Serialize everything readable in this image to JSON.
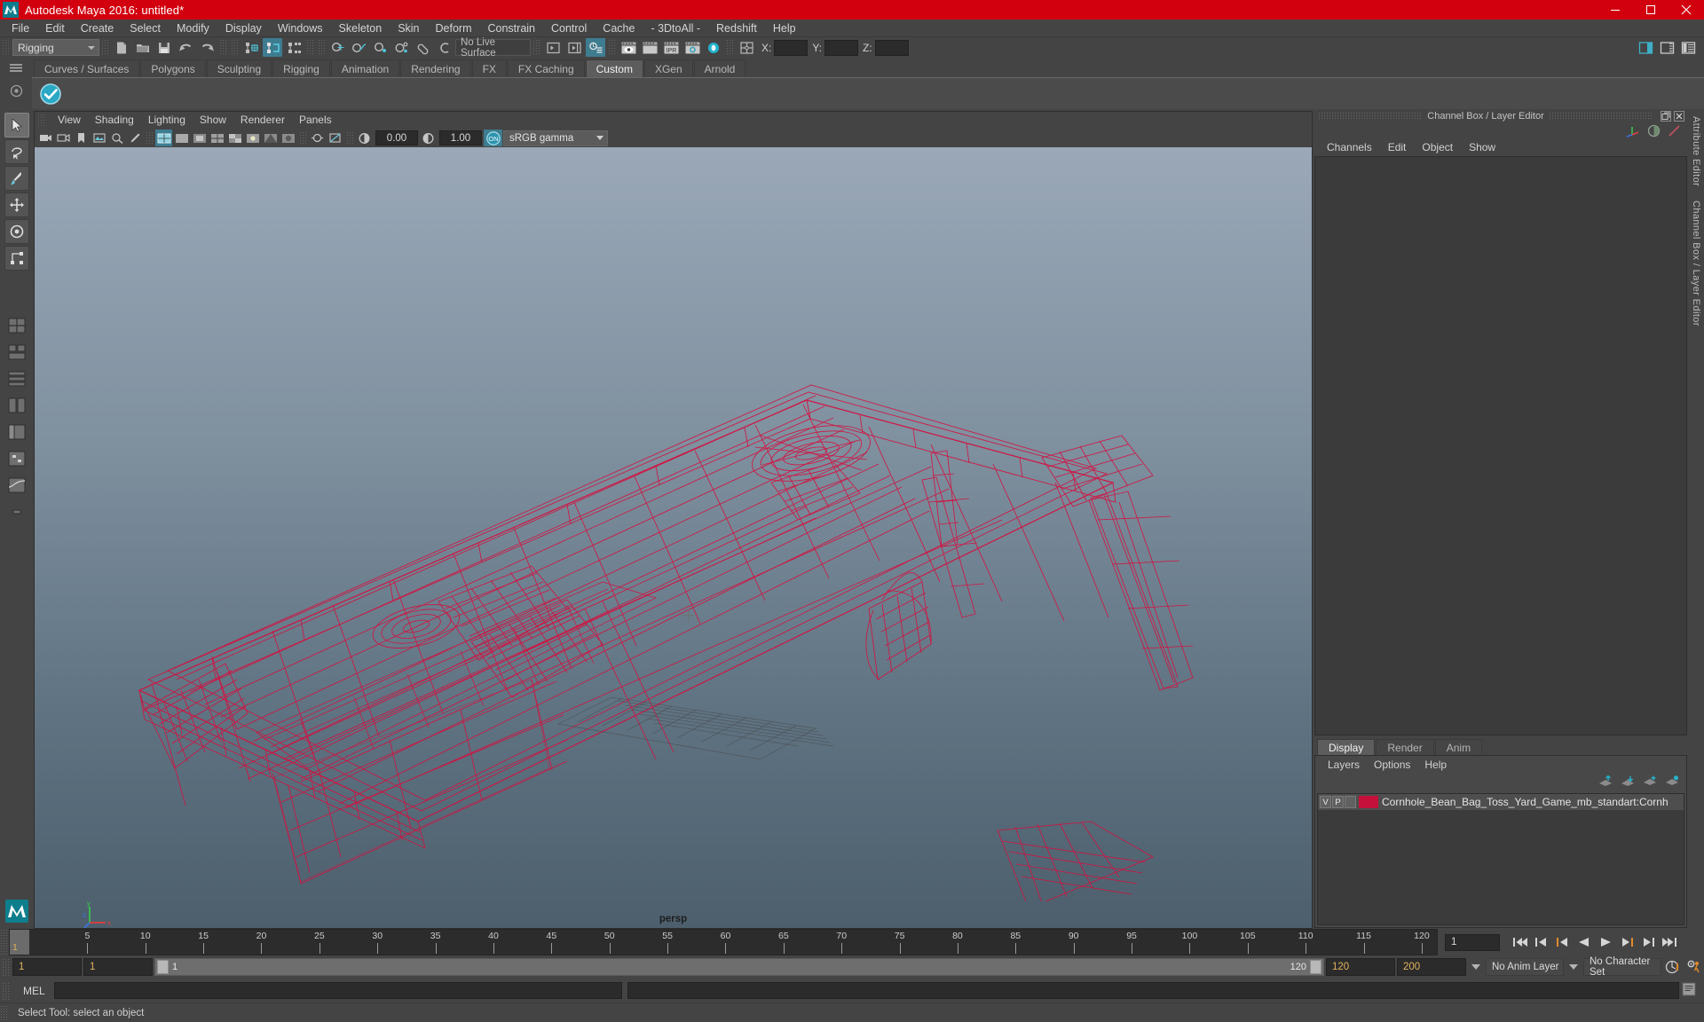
{
  "window": {
    "title": "Autodesk Maya 2016: untitled*",
    "titlebar_color": "#d2000f",
    "minimize": "minimize-icon",
    "maximize": "maximize-icon",
    "close": "close-icon"
  },
  "main_menu": [
    "File",
    "Edit",
    "Create",
    "Select",
    "Modify",
    "Display",
    "Windows",
    "Skeleton",
    "Skin",
    "Deform",
    "Constrain",
    "Control",
    "Cache",
    "- 3DtoAll -",
    "Redshift",
    "Help"
  ],
  "status_line": {
    "menu_set": "Rigging",
    "live_surface": "No Live Surface",
    "coord_labels": [
      "X:",
      "Y:",
      "Z:"
    ],
    "coord_values": [
      "",
      "",
      ""
    ]
  },
  "shelf": {
    "tabs": [
      "Curves / Surfaces",
      "Polygons",
      "Sculpting",
      "Rigging",
      "Animation",
      "Rendering",
      "FX",
      "FX Caching",
      "Custom",
      "XGen",
      "Arnold"
    ],
    "active_tab": "Custom"
  },
  "viewport": {
    "menus": [
      "View",
      "Shading",
      "Lighting",
      "Show",
      "Renderer",
      "Panels"
    ],
    "exposure": "0.00",
    "gamma": "1.00",
    "color_profile": "sRGB gamma",
    "camera_label": "persp",
    "wireframe_color": "#d31140",
    "grid_color": "#4d4d4d",
    "axis_labels": [
      "x",
      "y",
      "z"
    ]
  },
  "channel_box": {
    "panel_title": "Channel Box / Layer Editor",
    "menus": [
      "Channels",
      "Edit",
      "Object",
      "Show"
    ]
  },
  "layer_editor": {
    "tabs": [
      "Display",
      "Render",
      "Anim"
    ],
    "active_tab": "Display",
    "menus": [
      "Layers",
      "Options",
      "Help"
    ],
    "columns": [
      "V",
      "P"
    ],
    "layers": [
      {
        "visible": "V",
        "playback": "P",
        "state": "",
        "color": "#c4103a",
        "name": "Cornhole_Bean_Bag_Toss_Yard_Game_mb_standart:Cornh"
      }
    ]
  },
  "attribute_editor": {
    "labels": [
      "Attribute Editor",
      "Channel Box / Layer Editor"
    ]
  },
  "timeline": {
    "ticks": [
      5,
      10,
      15,
      20,
      25,
      30,
      35,
      40,
      45,
      50,
      55,
      60,
      65,
      70,
      75,
      80,
      85,
      90,
      95,
      100,
      105,
      110,
      115,
      120
    ],
    "current_frame": "1",
    "current_frame_field": "1",
    "playback_buttons": [
      "go-to-start",
      "step-back-key",
      "step-back-frame",
      "play-backwards",
      "play-forwards",
      "step-forward-frame",
      "step-forward-key",
      "go-to-end"
    ]
  },
  "range_slider": {
    "anim_start": "1",
    "playback_start": "1",
    "range_left_label": "1",
    "range_right_label": "120",
    "playback_end": "120",
    "anim_end": "200",
    "anim_layer": "No Anim Layer",
    "character_set": "No Character Set"
  },
  "command_line": {
    "language": "MEL",
    "input_value": "",
    "result_value": ""
  },
  "help_line": {
    "text": "Select Tool: select an object"
  }
}
